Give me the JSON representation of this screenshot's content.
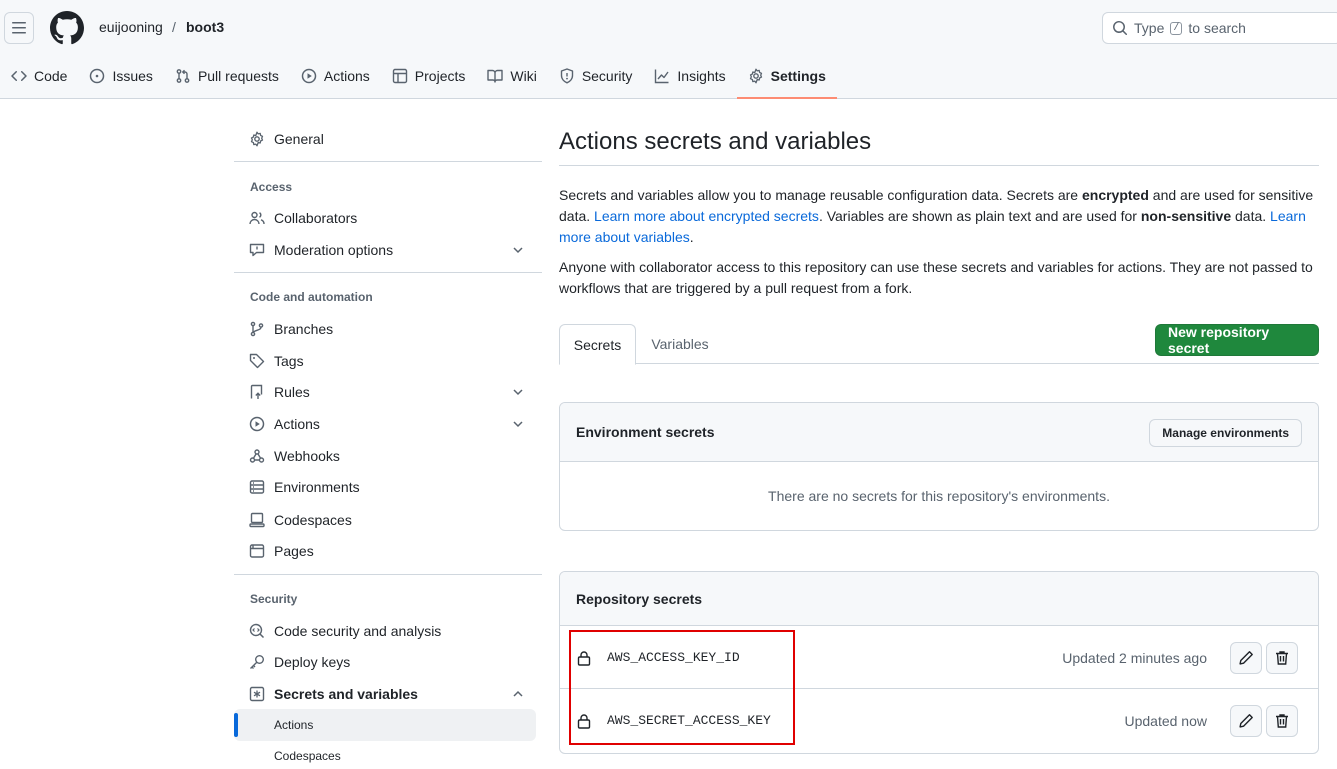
{
  "header": {
    "owner": "euijooning",
    "separator": "/",
    "repo": "boot3",
    "search": {
      "prefix": "Type",
      "key": "/",
      "suffix": "to search"
    }
  },
  "repo_tabs": [
    {
      "label": "Code",
      "icon": "code-icon"
    },
    {
      "label": "Issues",
      "icon": "issue-icon"
    },
    {
      "label": "Pull requests",
      "icon": "pull-request-icon"
    },
    {
      "label": "Actions",
      "icon": "play-icon"
    },
    {
      "label": "Projects",
      "icon": "table-icon"
    },
    {
      "label": "Wiki",
      "icon": "book-icon"
    },
    {
      "label": "Security",
      "icon": "shield-icon"
    },
    {
      "label": "Insights",
      "icon": "graph-icon"
    },
    {
      "label": "Settings",
      "icon": "gear-icon",
      "active": true
    }
  ],
  "sidebar": {
    "general": "General",
    "access_heading": "Access",
    "access": [
      "Collaborators",
      "Moderation options"
    ],
    "code_heading": "Code and automation",
    "code": [
      "Branches",
      "Tags",
      "Rules",
      "Actions",
      "Webhooks",
      "Environments",
      "Codespaces",
      "Pages"
    ],
    "security_heading": "Security",
    "security": [
      "Code security and analysis",
      "Deploy keys",
      "Secrets and variables"
    ],
    "secrets_sub": [
      "Actions",
      "Codespaces"
    ]
  },
  "main": {
    "title": "Actions secrets and variables",
    "intro": {
      "t1": "Secrets and variables allow you to manage reusable configuration data. Secrets are ",
      "b1": "encrypted",
      "t2": " and are used for sensitive data. ",
      "link1": "Learn more about encrypted secrets",
      "t3": ". Variables are shown as plain text and are used for ",
      "b2": "non-sensitive",
      "t4": " data. ",
      "link2": "Learn more about variables",
      "t5": "."
    },
    "access_note": "Anyone with collaborator access to this repository can use these secrets and variables for actions. They are not passed to workflows that are triggered by a pull request from a fork.",
    "tabs": [
      "Secrets",
      "Variables"
    ],
    "new_secret_button": "New repository secret",
    "env": {
      "title": "Environment secrets",
      "button": "Manage environments",
      "empty": "There are no secrets for this repository's environments."
    },
    "repo_secrets": {
      "title": "Repository secrets",
      "items": [
        {
          "name": "AWS_ACCESS_KEY_ID",
          "updated": "Updated 2 minutes ago"
        },
        {
          "name": "AWS_SECRET_ACCESS_KEY",
          "updated": "Updated now"
        }
      ]
    }
  },
  "colors": {
    "primary_button": "#1f883d",
    "link": "#0969da",
    "active_tab_underline": "#fd8c73",
    "highlight_box": "#e00000"
  }
}
